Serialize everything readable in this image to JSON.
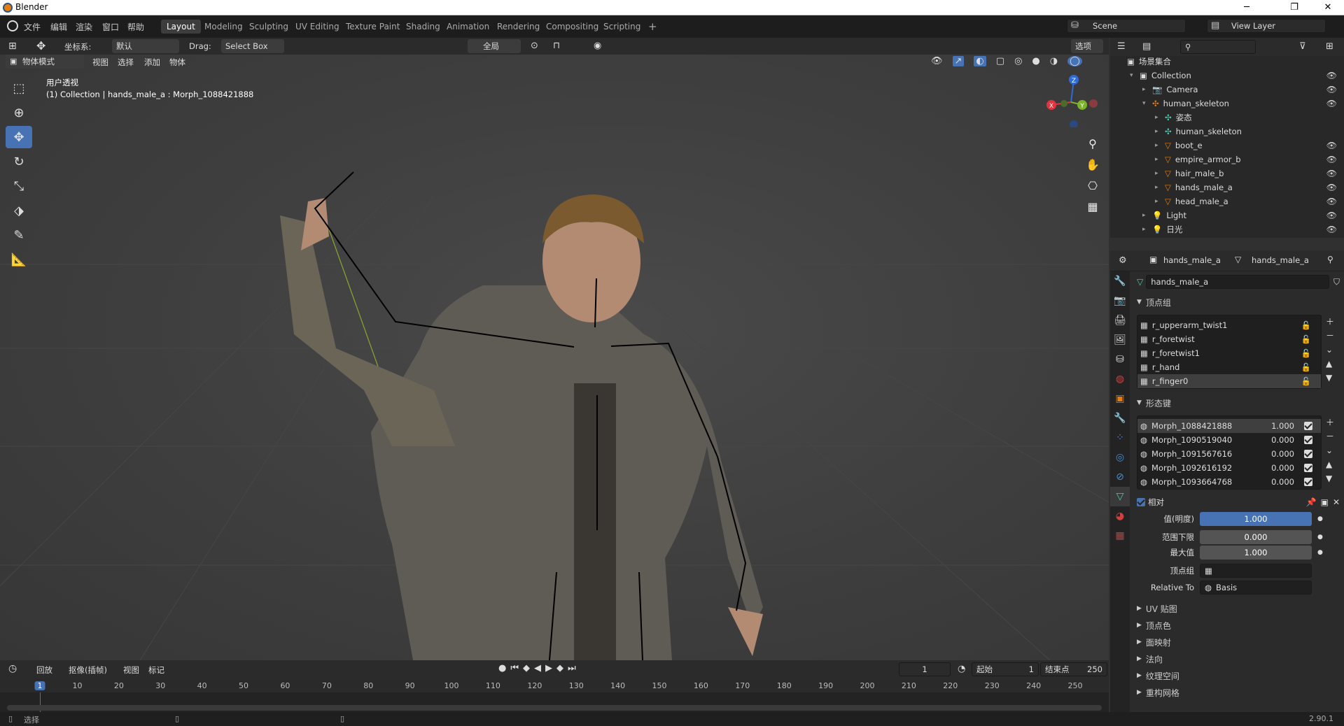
{
  "window": {
    "title": "Blender",
    "minimize": "─",
    "maximize": "❐",
    "close": "✕"
  },
  "menu": {
    "items": [
      "文件",
      "编辑",
      "渲染",
      "窗口",
      "帮助"
    ]
  },
  "workspaces": [
    "Layout",
    "Modeling",
    "Sculpting",
    "UV Editing",
    "Texture Paint",
    "Shading",
    "Animation",
    "Rendering",
    "Compositing",
    "Scripting"
  ],
  "workspace_add": "+",
  "scene": {
    "name": "Scene",
    "view_layer": "View Layer"
  },
  "viewport_header": {
    "coord_label": "坐标系:",
    "coord_value": "默认",
    "drag_label": "Drag:",
    "drag_value": "Select Box",
    "transform_global": "全局",
    "options": "选项",
    "mode": "物体模式",
    "view": "视图",
    "select": "选择",
    "add": "添加",
    "object": "物体"
  },
  "viewport": {
    "view_name": "用户透视",
    "object_info": "(1) Collection | hands_male_a : Morph_1088421888",
    "gizmo": {
      "z": "Z",
      "x": "X",
      "y": "Y"
    }
  },
  "timeline": {
    "playback": "回放",
    "keying": "抠像(插帧)",
    "view": "视图",
    "marker": "标记",
    "current_frame": "1",
    "start_label": "起始",
    "start_value": "1",
    "end_label": "结束点",
    "end_value": "250",
    "ticks": [
      "1",
      "10",
      "20",
      "30",
      "40",
      "50",
      "60",
      "70",
      "80",
      "90",
      "100",
      "110",
      "120",
      "130",
      "140",
      "150",
      "160",
      "170",
      "180",
      "190",
      "200",
      "210",
      "220",
      "230",
      "240",
      "250"
    ]
  },
  "status": {
    "select": "选择",
    "version": "2.90.1"
  },
  "outliner": {
    "root": "场景集合",
    "items": [
      {
        "label": "Collection",
        "indent": 1
      },
      {
        "label": "Camera",
        "indent": 2
      },
      {
        "label": "human_skeleton",
        "indent": 2
      },
      {
        "label": "姿态",
        "indent": 3
      },
      {
        "label": "human_skeleton",
        "indent": 3
      },
      {
        "label": "boot_e",
        "indent": 3
      },
      {
        "label": "empire_armor_b",
        "indent": 3
      },
      {
        "label": "hair_male_b",
        "indent": 3
      },
      {
        "label": "hands_male_a",
        "indent": 3
      },
      {
        "label": "head_male_a",
        "indent": 3
      },
      {
        "label": "Light",
        "indent": 2
      },
      {
        "label": "日光",
        "indent": 2
      }
    ]
  },
  "properties": {
    "object_name": "hands_male_a",
    "mesh_name": "hands_male_a",
    "data_field": "hands_male_a",
    "vertex_groups_title": "顶点组",
    "vertex_groups": [
      "r_upperarm_twist1",
      "r_foretwist",
      "r_foretwist1",
      "r_hand",
      "r_finger0"
    ],
    "shape_keys_title": "形态键",
    "shape_keys": [
      {
        "name": "Morph_1088421888",
        "value": "1.000"
      },
      {
        "name": "Morph_1090519040",
        "value": "0.000"
      },
      {
        "name": "Morph_1091567616",
        "value": "0.000"
      },
      {
        "name": "Morph_1092616192",
        "value": "0.000"
      },
      {
        "name": "Morph_1093664768",
        "value": "0.000"
      }
    ],
    "relative_label": "相对",
    "value_label": "值(明度)",
    "value": "1.000",
    "value_fraction": 1.0,
    "range_min_label": "范围下限",
    "range_min": "0.000",
    "max_label": "最大值",
    "max": "1.000",
    "vgroup_label": "顶点组",
    "relative_to_label": "Relative To",
    "relative_to": "Basis",
    "sections": [
      "UV 贴图",
      "顶点色",
      "面映射",
      "法向",
      "纹理空间",
      "重构网格"
    ]
  },
  "colors": {
    "accent": "#4772b3",
    "selected_orange": "#e87d0d",
    "mesh_green": "#4ec9b0"
  }
}
